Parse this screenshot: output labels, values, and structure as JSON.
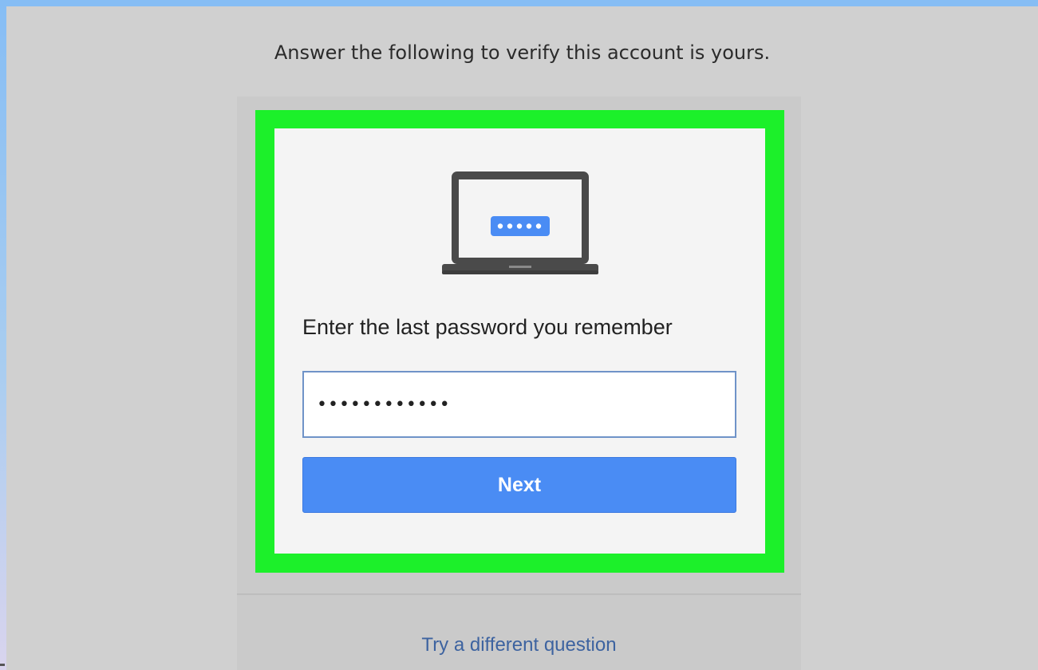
{
  "header": {
    "instruction": "Answer the following to verify this account is yours."
  },
  "challenge": {
    "icon": "laptop-password-icon",
    "prompt": "Enter the last password you remember",
    "password_value": "••••••••••••",
    "next_label": "Next"
  },
  "footer": {
    "alt_link": "Try a different question"
  },
  "colors": {
    "highlight": "#1cf02a",
    "button": "#4a8cf4",
    "link": "#3d63a0",
    "page_bg": "#d0d0d0"
  }
}
